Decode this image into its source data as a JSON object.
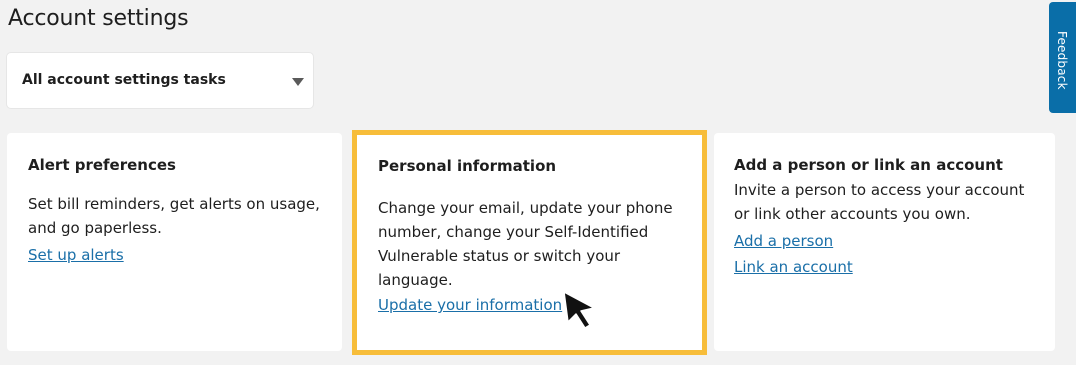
{
  "page": {
    "title": "Account settings"
  },
  "task_select": {
    "selected": "All account settings tasks",
    "caret_icon": "caret-down-icon"
  },
  "feedback": {
    "label": "Feedback",
    "color": "#0a6ea8"
  },
  "cards": [
    {
      "title": "Alert preferences",
      "body": "Set bill reminders, get alerts on usage, and go paperless.",
      "links": [
        "Set up alerts"
      ]
    },
    {
      "title": "Personal information",
      "body": "Change your email, update your phone number, change your Self-Identified Vulnerable status or switch your language.",
      "links": [
        "Update your information"
      ],
      "highlighted": true,
      "highlight_color": "#f7bd3a"
    },
    {
      "title": "Add a person or link an account",
      "body": "Invite a person to access your account or link other accounts you own.",
      "links": [
        "Add a person",
        "Link an account"
      ]
    }
  ],
  "colors": {
    "background": "#f2f2f2",
    "link": "#1a6fa8",
    "text": "#1e1e1e"
  },
  "cursor_icon": "mouse-pointer-icon"
}
